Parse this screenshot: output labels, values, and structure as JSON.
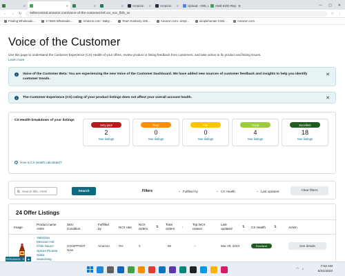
{
  "browser": {
    "tabs": [
      {
        "label": "",
        "color": "#3b7a3b"
      },
      {
        "label": "",
        "color": "#34a853"
      },
      {
        "label": "",
        "color": "#2d8a4e"
      },
      {
        "label": "",
        "color": "#1a7f5a"
      },
      {
        "label": "Amazon",
        "color": "#232f3e"
      },
      {
        "label": "Amazon",
        "color": "#232f3e"
      },
      {
        "label": "Upload - AWL LABEL",
        "color": "#4285f4"
      },
      {
        "label": "AMZ EOD Report",
        "color": "#34a853"
      }
    ],
    "url": "sellercentral.amazon.com/voice-of-the-customer/ref=xx_voc_fb/b_xx",
    "bookmarks": [
      "Finding Wholesale...",
      "17 Best Wholesale...",
      "Amazon.com : Baby...",
      "Team Kimberly Onli...",
      "Amazon.com: simpl...",
      "simplehuman CW2...",
      "Amazon.com"
    ]
  },
  "page": {
    "title": "Voice of the Customer",
    "intro": "Use this page to understand the Customer Experience (CX) Health of your offers, review product or listing feedback from customers, and take action to fix product and listing issues.",
    "learn_more": "Learn more",
    "banner1": "Voice of the Customer Beta: You are experiencing the new Voice of the Customer Dashboard. We have added new sources of customer feedback and insights to help you identify customer trends.",
    "banner2": "The Customer Experience (CX) rating of your product listings does not affect your overall account health.",
    "close_glyph": "✕",
    "info_glyph": "i"
  },
  "cx": {
    "title": "CX Health breakdown of your listings",
    "link": "How is CX Health calculated?",
    "see_listings": "See listings",
    "buckets": [
      {
        "label": "Very poor",
        "count": "2",
        "bg": "#b71c1c",
        "fg": "#ffffff"
      },
      {
        "label": "Poor",
        "count": "0",
        "bg": "#ff8f00",
        "fg": "#ffffff"
      },
      {
        "label": "Fair",
        "count": "0",
        "bg": "#ffc400",
        "fg": "#ffffff"
      },
      {
        "label": "Good",
        "count": "4",
        "bg": "#9ccc3c",
        "fg": "#ffffff"
      },
      {
        "label": "Excellent",
        "count": "18",
        "bg": "#1f5e1f",
        "fg": "#ffffff"
      }
    ]
  },
  "filters": {
    "search_placeholder": "Search title, ASIN",
    "search_button": "Search",
    "title": "Filters",
    "dropdowns": [
      "Fulfilled by",
      "CX Health",
      "Last updated"
    ],
    "clear_button": "Clear filters"
  },
  "table": {
    "title": "24 Offer Listings",
    "columns": {
      "image": "Image",
      "product": "Product name\nASIN",
      "sku": "SKU\nCondition",
      "fulfilled": "Fulfilled\nby",
      "ncx_rate": "NCX rate",
      "ncx_orders": "NCX\norders",
      "total_orders": "Total\norders",
      "top_reason": "Top NCX\nreason",
      "last_updated": "Last\nupdated",
      "cx_health": "CX Health",
      "action": "Action"
    },
    "row": {
      "product_name": "Valentina\nMexican Hot\nChile Sauce\nSpices Picante\nSalsa\nSeasoning\nSalt Spice Mix\nMade From\nChili Peppers\nPerfect For\nChips Salt",
      "sku": "XX03PP60IT",
      "condition": "New",
      "fulfilled_by": "Amazon",
      "ncx_rate": "0%",
      "ncx_orders": "0",
      "total_orders": "86",
      "top_reason": "--",
      "last_updated": "Mar 29, 2023",
      "cx_health": "Excellent",
      "action": "See details"
    }
  },
  "feedback": "FEEDBACK",
  "taskbar": {
    "time": "7:53 AM",
    "date": "6/31/2023",
    "icon_colors": [
      "#1e88e5",
      "#616161",
      "#1565c0",
      "#43a047",
      "#fb8c00",
      "#e53935",
      "#0277bd",
      "#5e35b1",
      "#00897b",
      "#212121",
      "#039be5",
      "#ffb300",
      "#d81b60"
    ]
  }
}
